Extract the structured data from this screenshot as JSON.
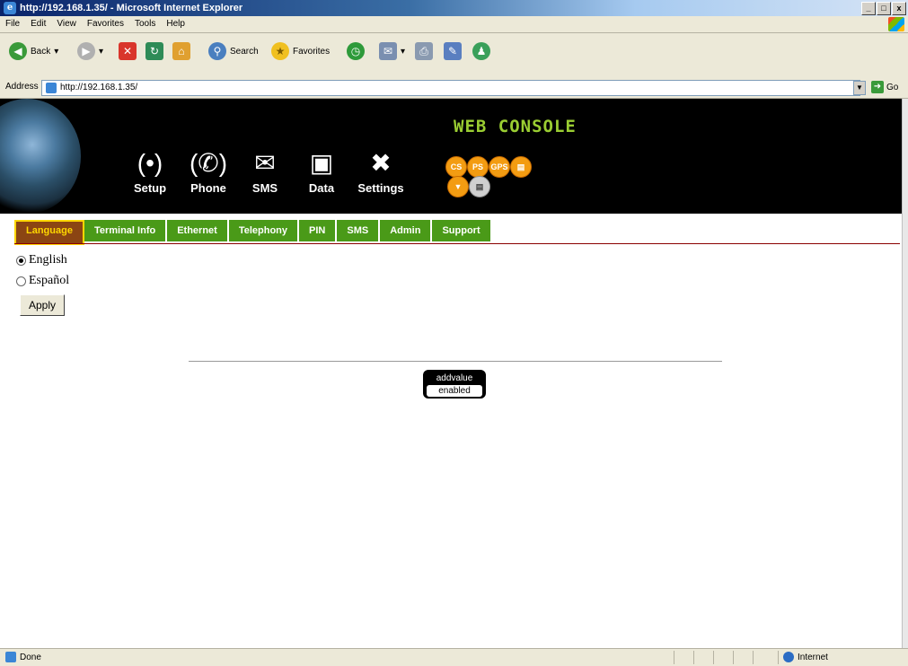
{
  "window": {
    "title": "http://192.168.1.35/ - Microsoft Internet Explorer",
    "controls": [
      "_",
      "□",
      "x"
    ]
  },
  "menu": [
    "File",
    "Edit",
    "View",
    "Favorites",
    "Tools",
    "Help"
  ],
  "toolbar": {
    "back": "Back",
    "search": "Search",
    "favorites": "Favorites"
  },
  "address": {
    "label": "Address",
    "url": "http://192.168.1.35/",
    "go": "Go"
  },
  "banner": {
    "title": "WEB CONSOLE",
    "nav": [
      {
        "label": "Setup",
        "icon": "bgan-icon"
      },
      {
        "label": "Phone",
        "icon": "phone-icon"
      },
      {
        "label": "SMS",
        "icon": "envelope-icon"
      },
      {
        "label": "Data",
        "icon": "monitor-icon"
      },
      {
        "label": "Settings",
        "icon": "tools-icon"
      }
    ],
    "status_icons": [
      "CS",
      "PS",
      "GPS",
      "",
      "",
      ""
    ]
  },
  "tabs": [
    "Language",
    "Terminal Info",
    "Ethernet",
    "Telephony",
    "PIN",
    "SMS",
    "Admin",
    "Support"
  ],
  "active_tab": "Language",
  "language": {
    "options": [
      "English",
      "Español"
    ],
    "selected": "English",
    "apply": "Apply"
  },
  "logo": {
    "line1": "addvalue",
    "line2": "enabled"
  },
  "statusbar": {
    "left": "Done",
    "zone": "Internet"
  }
}
